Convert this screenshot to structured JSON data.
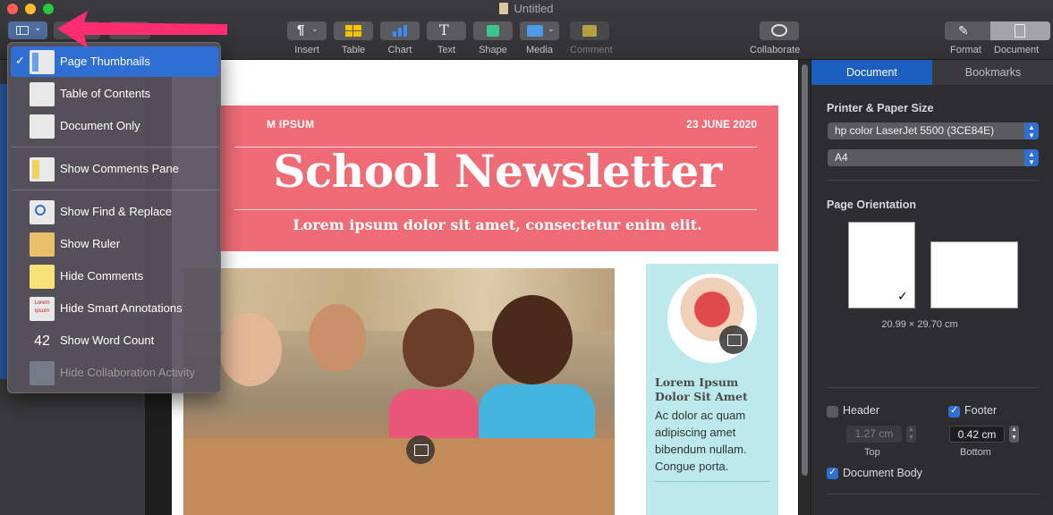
{
  "window": {
    "title": "Untitled"
  },
  "toolbar": {
    "insert": "Insert",
    "table": "Table",
    "chart": "Chart",
    "text": "Text",
    "shape": "Shape",
    "media": "Media",
    "comment": "Comment",
    "collaborate": "Collaborate",
    "format": "Format",
    "document": "Document"
  },
  "view_menu": {
    "items": [
      {
        "label": "Page Thumbnails",
        "icon": "page-thumbnails-icon",
        "checked": true
      },
      {
        "label": "Table of Contents",
        "icon": "table-of-contents-icon"
      },
      {
        "label": "Document Only",
        "icon": "document-only-icon"
      },
      {
        "label": "Show Comments Pane",
        "icon": "comments-pane-icon"
      },
      {
        "label": "Show Find & Replace",
        "icon": "magnifier-icon"
      },
      {
        "label": "Show Ruler",
        "icon": "ruler-icon"
      },
      {
        "label": "Hide Comments",
        "icon": "comment-note-icon"
      },
      {
        "label": "Hide Smart Annotations",
        "icon": "smart-annotation-icon",
        "icon_text": "Lorem ipsum"
      },
      {
        "label": "Show Word Count",
        "icon": "word-count-icon",
        "icon_text": "42"
      },
      {
        "label": "Hide Collaboration Activity",
        "icon": "collaboration-icon",
        "disabled": true
      }
    ]
  },
  "document": {
    "banner_left": "M IPSUM",
    "banner_date": "23 JUNE 2020",
    "title": "School Newsletter",
    "subtitle": "Lorem ipsum dolor sit amet, consectetur enim elit.",
    "side_heading": "Lorem Ipsum Dolor Sit Amet",
    "side_body": "Ac dolor ac quam adipiscing amet bibendum nullam. Congue porta."
  },
  "inspector": {
    "tabs": [
      "Document",
      "Bookmarks"
    ],
    "printer_heading": "Printer & Paper Size",
    "printer": "hp color LaserJet 5500 (3CE84E)",
    "paper": "A4",
    "orientation_heading": "Page Orientation",
    "dimensions": "20.99 × 29.70 cm",
    "header_label": "Header",
    "footer_label": "Footer",
    "header_value": "1.27 cm",
    "footer_value": "0.42 cm",
    "top_caption": "Top",
    "bottom_caption": "Bottom",
    "body_label": "Document Body"
  },
  "colors": {
    "accent": "#2f6ed2",
    "banner": "#ef6c76",
    "sidebox": "#bce9ec",
    "annotation_arrow": "#ff2d6f"
  }
}
